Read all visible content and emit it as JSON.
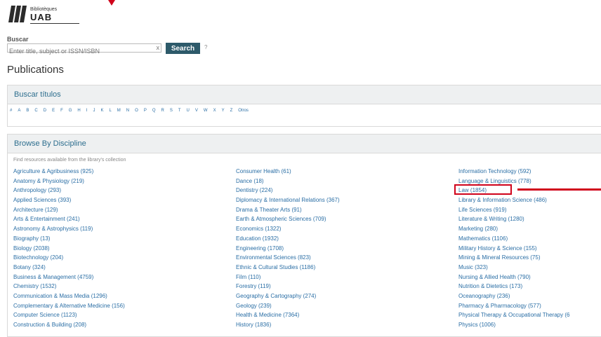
{
  "logo": {
    "small_text": "Bibliotèques",
    "big_text": "UAB"
  },
  "search": {
    "label": "Buscar",
    "placeholder": "Enter title, subject or ISSN/ISBN",
    "clear": "x",
    "button": "Search",
    "help": "?"
  },
  "page_title": "Publications",
  "titles_panel": {
    "heading": "Buscar títulos",
    "letters": [
      "#",
      "A",
      "B",
      "C",
      "D",
      "E",
      "F",
      "G",
      "H",
      "I",
      "J",
      "K",
      "L",
      "M",
      "N",
      "O",
      "P",
      "Q",
      "R",
      "S",
      "T",
      "U",
      "V",
      "W",
      "X",
      "Y",
      "Z",
      "Otros"
    ]
  },
  "discipline_panel": {
    "heading": "Browse By Discipline",
    "note": "Find resources available from the library's collection",
    "col1": [
      "Agriculture & Agribusiness (925)",
      "Anatomy & Physiology (219)",
      "Anthropology (293)",
      "Applied Sciences (393)",
      "Architecture (129)",
      "Arts & Entertainment (241)",
      "Astronomy & Astrophysics (119)",
      "Biography (13)",
      "Biology (2038)",
      "Biotechnology (204)",
      "Botany (324)",
      "Business & Management (4759)",
      "Chemistry (1532)",
      "Communication & Mass Media (1296)",
      "Complementary & Alternative Medicine (156)",
      "Computer Science (1123)",
      "Construction & Building (208)"
    ],
    "col2": [
      "Consumer Health (61)",
      "Dance (18)",
      "Dentistry (224)",
      "Diplomacy & International Relations (367)",
      "Drama & Theater Arts (91)",
      "Earth & Atmospheric Sciences (709)",
      "Economics (1322)",
      "Education (1932)",
      "Engineering (1708)",
      "Environmental Sciences (823)",
      "Ethnic & Cultural Studies (1186)",
      "Film (110)",
      "Forestry (119)",
      "Geography & Cartography (274)",
      "Geology (239)",
      "Health & Medicine (7364)",
      "History (1836)"
    ],
    "col3": [
      "Information Technology (592)",
      "Language & Linguistics (778)",
      "Law (1854)",
      "Library & Information Science (486)",
      "Life Sciences (919)",
      "Literature & Writing (1280)",
      "Marketing (280)",
      "Mathematics (1106)",
      "Military History & Science (155)",
      "Mining & Mineral Resources (75)",
      "Music (323)",
      "Nursing & Allied Health (790)",
      "Nutrition & Dietetics (173)",
      "Oceanography (236)",
      "Pharmacy & Pharmacology (577)",
      "Physical Therapy & Occupational Therapy (6",
      "Physics (1006)"
    ]
  },
  "colors": {
    "accent": "#2d5a6a",
    "link": "#2a6ea5",
    "highlight": "#d0021b"
  }
}
